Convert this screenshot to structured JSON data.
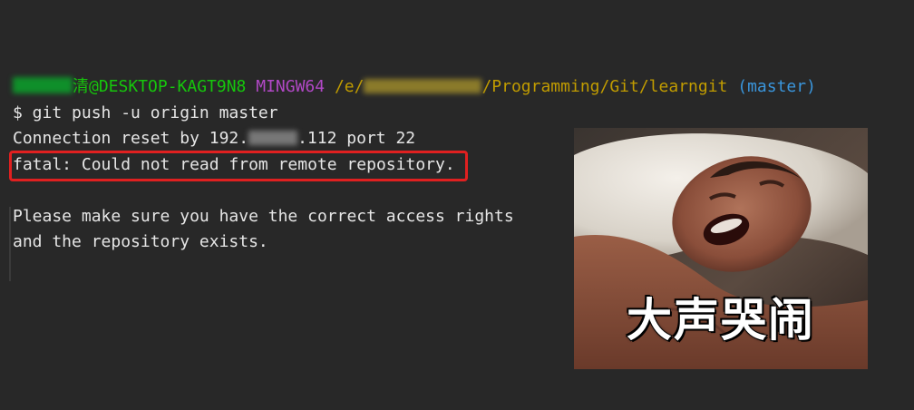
{
  "prompt": {
    "user_suffix": "清",
    "host": "@DESKTOP-KAGT9N8",
    "env": "MINGW64",
    "path_prefix": "/e/",
    "path_suffix": "/Programming/Git/learngit",
    "branch": "(master)"
  },
  "command": "$ git push -u origin master",
  "output": {
    "connection_prefix": "Connection reset by 192.",
    "connection_suffix": ".112 port 22",
    "fatal": "fatal: Could not read from remote repository.",
    "hint_line1": "Please make sure you have the correct access rights",
    "hint_line2": "and the repository exists."
  },
  "meme": {
    "caption": "大声哭闹"
  },
  "colors": {
    "background": "#282828",
    "text": "#e6e6e6",
    "prompt_green": "#16c60c",
    "prompt_purple": "#b148c6",
    "prompt_path": "#c19c00",
    "prompt_branch": "#3a96dd",
    "highlight_red": "#e02020"
  }
}
